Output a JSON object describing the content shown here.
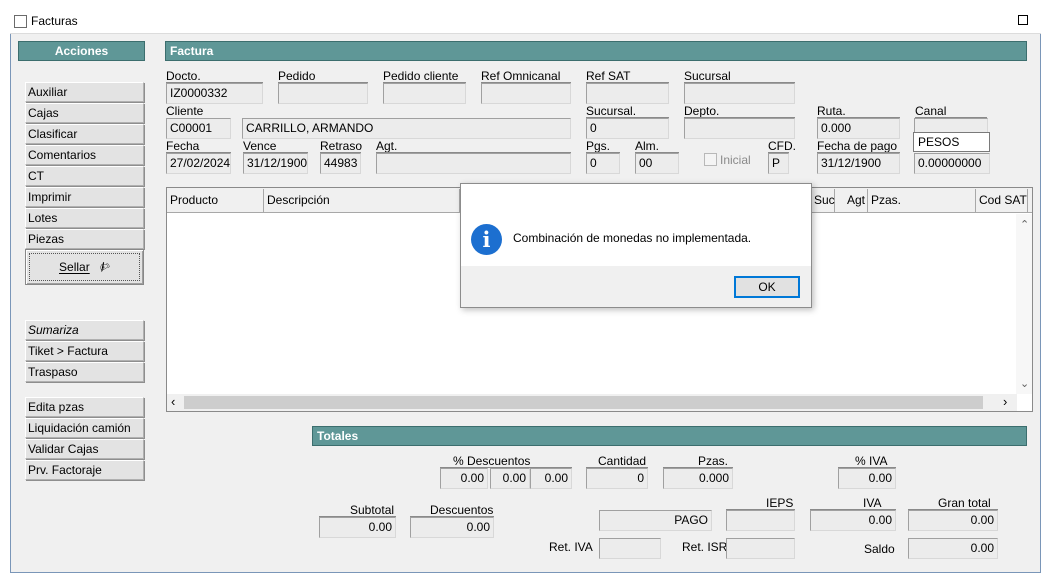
{
  "window": {
    "title": "Facturas"
  },
  "sidebar": {
    "header": "Acciones",
    "group1": [
      "Auxiliar",
      "Cajas",
      "Clasificar",
      "Comentarios",
      "CT",
      "Imprimir",
      "Lotes",
      "Piezas"
    ],
    "sellar_label": "Sellar",
    "group2": [
      "Sumariza",
      "Tiket > Factura",
      "Traspaso"
    ],
    "group3": [
      "Edita pzas",
      "Liquidación camión",
      "Validar Cajas",
      "Prv. Factoraje"
    ]
  },
  "factura": {
    "header": "Factura",
    "docto_label": "Docto.",
    "docto_value": "IZ0000332",
    "pedido_label": "Pedido",
    "pedido_value": "",
    "pedido_cliente_label": "Pedido cliente",
    "pedido_cliente_value": "",
    "ref_omnicanal_label": "Ref Omnicanal",
    "ref_omnicanal_value": "",
    "ref_sat_label": "Ref SAT",
    "ref_sat_value": "",
    "sucursal_label": "Sucursal",
    "sucursal_value": "",
    "cliente_label": "Cliente",
    "cliente_code": "C00001",
    "cliente_name": "CARRILLO, ARMANDO",
    "sucursal2_label": "Sucursal.",
    "sucursal2_value": "0",
    "depto_label": "Depto.",
    "depto_value": "",
    "ruta_label": "Ruta.",
    "ruta_value": "0.000",
    "canal_label": "Canal",
    "canal_value": "",
    "canal_option": "PESOS",
    "fecha_label": "Fecha",
    "fecha_value": "27/02/2024",
    "vence_label": "Vence",
    "vence_value": "31/12/1900",
    "retraso_label": "Retraso",
    "retraso_value": "44983",
    "agt_label": "Agt.",
    "agt_value": "",
    "pgs_label": "Pgs.",
    "pgs_value": "0",
    "alm_label": "Alm.",
    "alm_value": "00",
    "inicial_label": "Inicial",
    "cfd_label": "CFD.",
    "cfd_value": "P",
    "fecha_pago_label": "Fecha de pago",
    "fecha_pago_value": "31/12/1900",
    "tipo_cambio_value": "0.00000000"
  },
  "grid": {
    "columns": [
      "Producto",
      "Descripción",
      "Suc",
      "Agt",
      "Pzas.",
      "Cod SAT"
    ]
  },
  "dialog": {
    "message": "Combinación de monedas no implementada.",
    "ok_label": "OK",
    "icon": "info-icon"
  },
  "totales": {
    "header": "Totales",
    "descuentos_pct_label": "% Descuentos",
    "desc1": "0.00",
    "desc2": "0.00",
    "desc3": "0.00",
    "cantidad_label": "Cantidad",
    "cantidad_value": "0",
    "pzas_label": "Pzas.",
    "pzas_value": "0.000",
    "iva_pct_label": "% IVA",
    "iva_pct_value": "0.00",
    "subtotal_label": "Subtotal",
    "subtotal_value": "0.00",
    "descuentos_label": "Descuentos",
    "descuentos_value": "0.00",
    "pago_value": "PAGO",
    "ieps_label": "IEPS",
    "ieps_value": "",
    "iva_label": "IVA",
    "iva_value": "0.00",
    "gran_total_label": "Gran total",
    "gran_total_value": "0.00",
    "ret_iva_label": "Ret. IVA",
    "ret_iva_value": "",
    "ret_isr_label": "Ret. ISR",
    "ret_isr_value": "",
    "saldo_label": "Saldo",
    "saldo_value": "0.00"
  },
  "colors": {
    "band": "#5f9797",
    "dialog_accent": "#0078d7",
    "info_icon": "#1c6fd0"
  }
}
